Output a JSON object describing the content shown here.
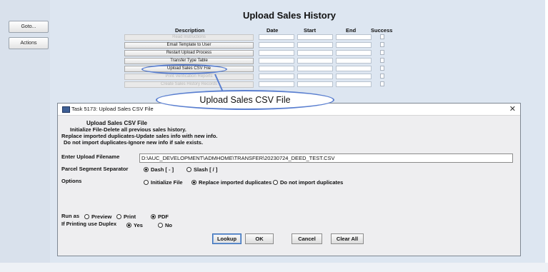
{
  "sidebar": {
    "goto_label": "Goto...",
    "actions_label": "Actions"
  },
  "page_title": "Upload Sales History",
  "columns": {
    "description": "Description",
    "date": "Date",
    "start": "Start",
    "end": "End",
    "success": "Success"
  },
  "tasks": [
    {
      "label": "Read Instructions",
      "enabled": false
    },
    {
      "label": "Email Template to User",
      "enabled": true
    },
    {
      "label": "Restart Upload Process",
      "enabled": true
    },
    {
      "label": "Transfer Type Table",
      "enabled": true
    },
    {
      "label": "Upload Sales CSV File",
      "enabled": true
    },
    {
      "label": "Print Verification Reports",
      "enabled": false
    },
    {
      "label": "Create Sales History Records",
      "enabled": false
    }
  ],
  "callout_label": "Upload Sales CSV File",
  "dialog": {
    "title": "Task 5173: Upload Sales CSV File",
    "heading": "Upload Sales CSV File",
    "instructions": [
      "Initialize File-Delete all previous sales history.",
      "Replace imported duplicates-Update sales info with new info.",
      "Do not import duplicates-Ignore new info if sale exists."
    ],
    "filename_label": "Enter Upload Filename",
    "filename_value": "D:\\AUC_DEVELOPMENT\\ADMHOME\\TRANSFER\\20230724_DEED_TEST.CSV",
    "separator_label": "Parcel Segment Separator",
    "separator_options": [
      "Dash [ - ]",
      "Slash [ / ]"
    ],
    "options_label": "Options",
    "options": [
      "Initialize File",
      "Replace imported duplicates",
      "Do not import duplicates"
    ],
    "runas_label": "Run as",
    "runas_options": [
      "Preview",
      "Print",
      "PDF"
    ],
    "duplex_label": "If Printing use Duplex",
    "duplex_options": [
      "Yes",
      "No"
    ],
    "buttons": {
      "lookup": "Lookup",
      "ok": "OK",
      "cancel": "Cancel",
      "clear_all": "Clear All"
    }
  }
}
